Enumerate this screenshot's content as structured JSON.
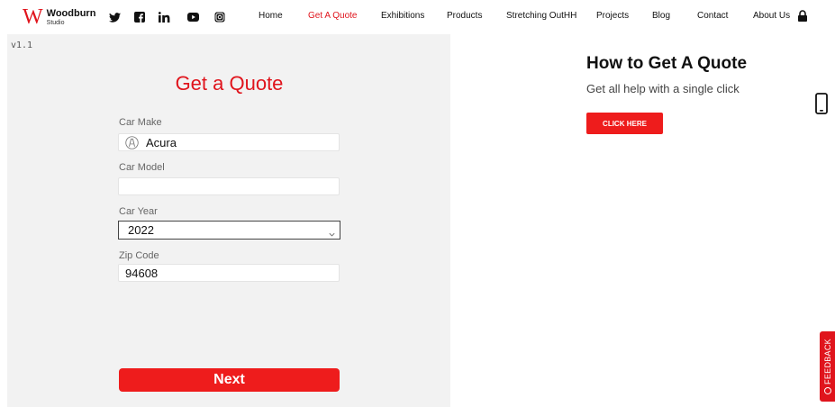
{
  "brand": {
    "mark": "W",
    "name": "Woodburn",
    "sub": "Studio"
  },
  "social": [
    "twitter-icon",
    "facebook-icon",
    "linkedin-icon",
    "youtube-icon",
    "instagram-icon"
  ],
  "nav": {
    "items": [
      {
        "label": "Home",
        "active": false
      },
      {
        "label": "Get A Quote",
        "active": true
      },
      {
        "label": "Exhibitions",
        "active": false
      },
      {
        "label": "Products",
        "active": false
      },
      {
        "label": "Stretching OutHH",
        "active": false
      },
      {
        "label": "Projects",
        "active": false
      },
      {
        "label": "Blog",
        "active": false
      },
      {
        "label": "Contact",
        "active": false
      },
      {
        "label": "About Us",
        "active": false
      }
    ]
  },
  "version": "v1.1",
  "form": {
    "title": "Get a Quote",
    "make_label": "Car Make",
    "make_value": "Acura",
    "model_label": "Car Model",
    "model_value": "",
    "year_label": "Car Year",
    "year_value": "2022",
    "zip_label": "Zip Code",
    "zip_value": "94608",
    "next_label": "Next"
  },
  "help": {
    "title": "How to Get A Quote",
    "subtitle": "Get all help with a single click",
    "button_label": "CLICK HERE"
  },
  "feedback": {
    "label": "FEEDBACK"
  },
  "colors": {
    "accent": "#e0141c",
    "button": "#ee1c1c",
    "panel": "#f2f2f2"
  }
}
